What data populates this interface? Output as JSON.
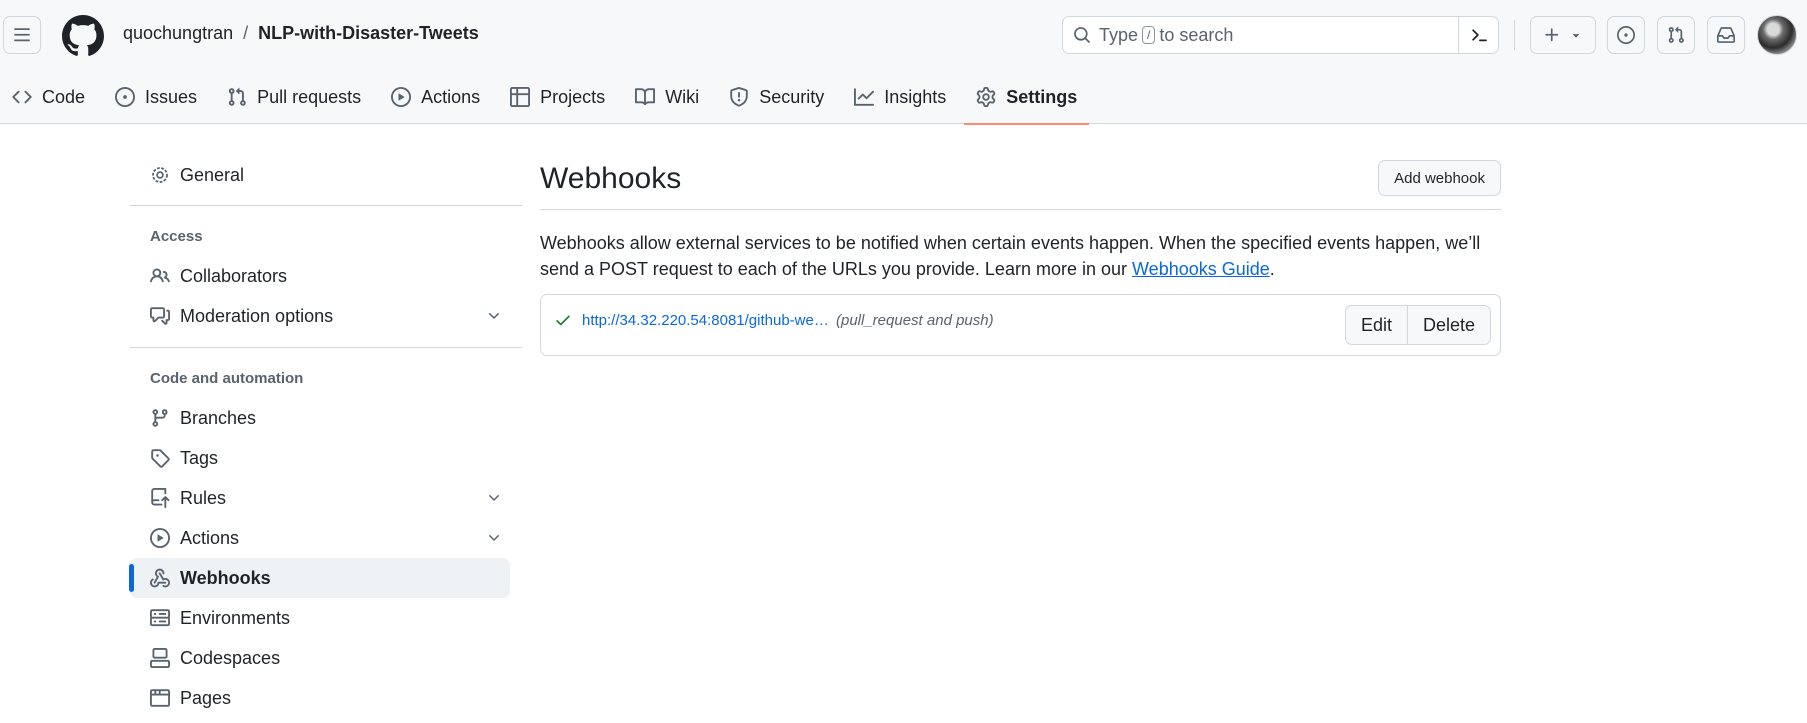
{
  "header": {
    "owner": "quochungtran",
    "separator": "/",
    "repo": "NLP-with-Disaster-Tweets",
    "search_prefix": "Type",
    "search_key": "/",
    "search_suffix": "to search"
  },
  "tabs": [
    {
      "label": "Code",
      "icon": "code-icon"
    },
    {
      "label": "Issues",
      "icon": "issue-opened-icon"
    },
    {
      "label": "Pull requests",
      "icon": "git-pull-request-icon"
    },
    {
      "label": "Actions",
      "icon": "play-icon"
    },
    {
      "label": "Projects",
      "icon": "table-icon"
    },
    {
      "label": "Wiki",
      "icon": "book-icon"
    },
    {
      "label": "Security",
      "icon": "shield-icon"
    },
    {
      "label": "Insights",
      "icon": "graph-icon"
    },
    {
      "label": "Settings",
      "icon": "gear-icon",
      "active": true
    }
  ],
  "sidebar": {
    "general": "General",
    "access_heading": "Access",
    "collaborators": "Collaborators",
    "moderation": "Moderation options",
    "code_heading": "Code and automation",
    "branches": "Branches",
    "tags": "Tags",
    "rules": "Rules",
    "actions": "Actions",
    "webhooks": "Webhooks",
    "environments": "Environments",
    "codespaces": "Codespaces",
    "pages": "Pages"
  },
  "main": {
    "title": "Webhooks",
    "add_button": "Add webhook",
    "description": "Webhooks allow external services to be notified when certain events happen. When the specified events happen, we’ll send a POST request to each of the URLs you provide. Learn more in our",
    "guide_link": "Webhooks Guide",
    "period": ".",
    "webhook": {
      "url": "http://34.32.220.54:8081/github-we…",
      "events": "(pull_request and push)",
      "edit_label": "Edit",
      "delete_label": "Delete",
      "status": "check-icon"
    }
  },
  "colors": {
    "accent": "#0969da",
    "active_tab_underline": "#fd8c73",
    "success": "#1a7f37"
  }
}
